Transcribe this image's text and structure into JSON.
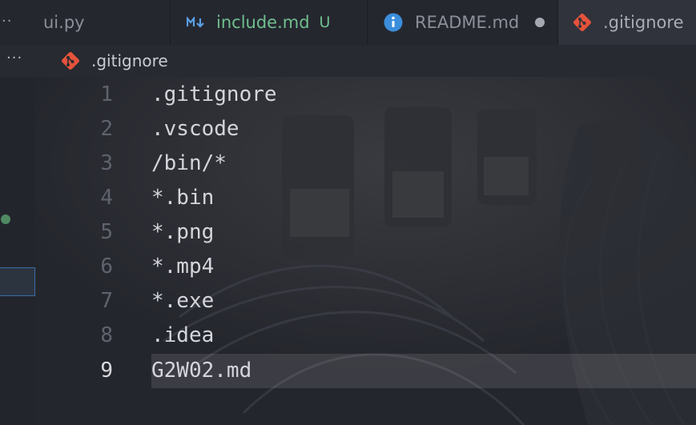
{
  "tabs": [
    {
      "label": "ui.py",
      "icon": "more-icon",
      "status": ""
    },
    {
      "label": "include.md",
      "icon": "markdown-icon",
      "status": "U",
      "color": "#6fbf8e"
    },
    {
      "label": "README.md",
      "icon": "info-icon",
      "status": "dot"
    },
    {
      "label": ".gitignore",
      "icon": "git-icon",
      "status": "",
      "active": true
    }
  ],
  "breadcrumb": {
    "more": "···",
    "file": ".gitignore",
    "icon": "git-icon"
  },
  "editor": {
    "lines": [
      {
        "number": "1",
        "text": ".gitignore"
      },
      {
        "number": "2",
        "text": ".vscode"
      },
      {
        "number": "3",
        "text": "/bin/*"
      },
      {
        "number": "4",
        "text": "*.bin"
      },
      {
        "number": "5",
        "text": "*.png"
      },
      {
        "number": "6",
        "text": "*.mp4"
      },
      {
        "number": "7",
        "text": "*.exe"
      },
      {
        "number": "8",
        "text": ".idea"
      },
      {
        "number": "9",
        "text": "G2W02.md"
      }
    ],
    "current_line": "9"
  },
  "colors": {
    "git_icon": "#e5533b",
    "info_icon": "#3b8edb",
    "untracked": "#6fbf8e",
    "accent_border": "#3b6fa6"
  }
}
